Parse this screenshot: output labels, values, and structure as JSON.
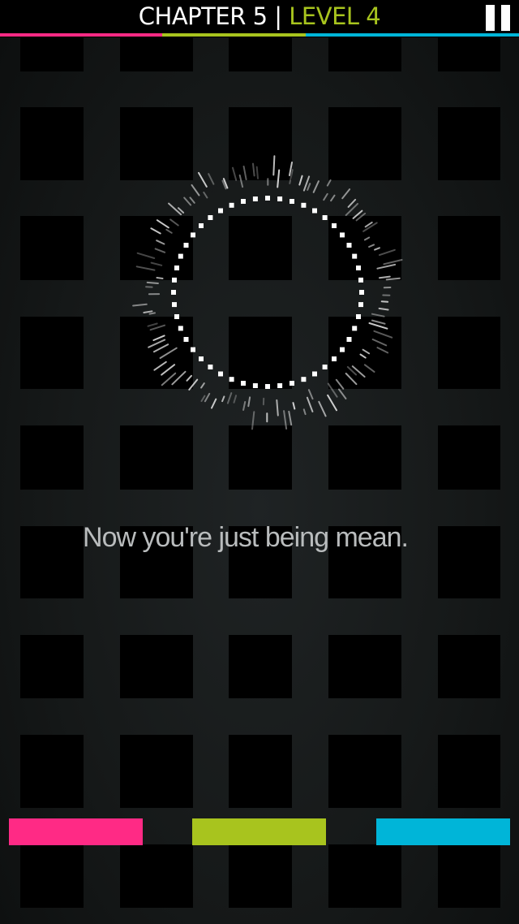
{
  "header": {
    "chapter_label": "CHAPTER 5",
    "separator": "|",
    "level_label": "LEVEL 4",
    "chapter_color": "#ffffff",
    "level_color": "#a8c41e"
  },
  "pause_icon": "pause-icon",
  "message": "Now you're just being mean.",
  "colors": {
    "pink": "#ff2a85",
    "green": "#a8c41e",
    "blue": "#00b5d8"
  },
  "color_buttons": [
    {
      "name": "pink",
      "color": "#ff2a85"
    },
    {
      "name": "green",
      "color": "#a8c41e"
    },
    {
      "name": "blue",
      "color": "#00b5d8"
    }
  ],
  "ring": {
    "color": "#ffffff",
    "dot_count": 48
  }
}
